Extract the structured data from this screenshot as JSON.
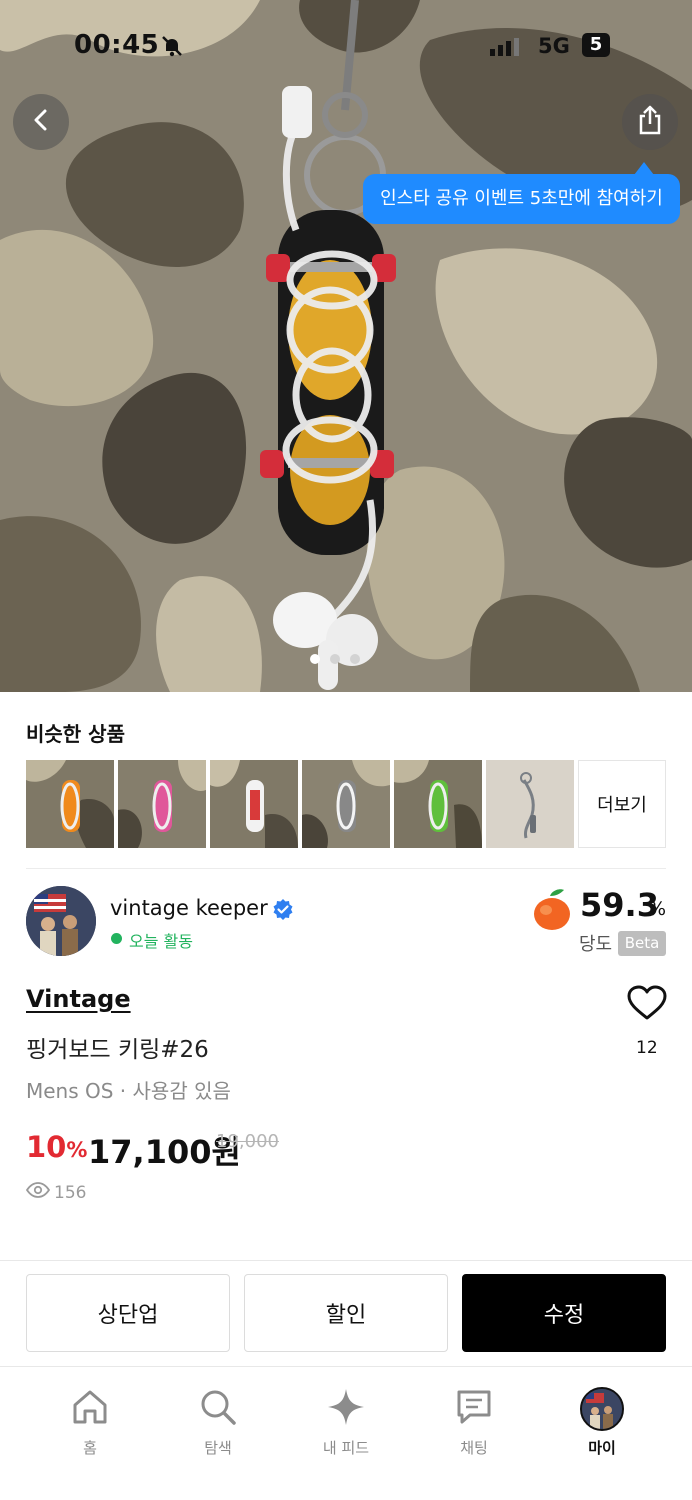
{
  "status_bar": {
    "time": "00:45",
    "network": "5G",
    "battery": "5"
  },
  "hero": {
    "tooltip": "인스타 공유 이벤트 5초만에 참여하기",
    "image_icons": {
      "back": "chevron-left-icon",
      "share": "share-icon"
    },
    "carousel": {
      "count": 3,
      "active": 1
    }
  },
  "similar": {
    "title": "비슷한 상품",
    "more_label": "더보기",
    "thumb_accents": [
      "#f08a1c",
      "#e0579a",
      "#d83a3a",
      "#888888",
      "#5fbf3c",
      "#7a7f85"
    ]
  },
  "seller": {
    "name": "vintage keeper",
    "activity": "오늘 활동",
    "sweetness_value": "59.3",
    "sweetness_unit": "%",
    "sweetness_label": "당도",
    "beta": "Beta"
  },
  "product": {
    "brand": "Vintage",
    "title": "핑거보드 키링#26",
    "meta": "Mens OS · 사용감 있음",
    "discount_value": "10",
    "discount_unit": "%",
    "price": "17,100원",
    "original_price": "19,000",
    "views": "156",
    "likes": "12"
  },
  "actions": {
    "bump": "상단업",
    "discount": "할인",
    "edit": "수정"
  },
  "nav": {
    "items": [
      {
        "label": "홈",
        "icon": "home-icon"
      },
      {
        "label": "탐색",
        "icon": "search-icon"
      },
      {
        "label": "내 피드",
        "icon": "sparkle-icon"
      },
      {
        "label": "채팅",
        "icon": "chat-icon"
      },
      {
        "label": "마이",
        "icon": "avatar"
      }
    ]
  },
  "colors": {
    "accent_blue": "#1f8bff",
    "discount_red": "#e22a32",
    "active_green": "#22b35e"
  }
}
